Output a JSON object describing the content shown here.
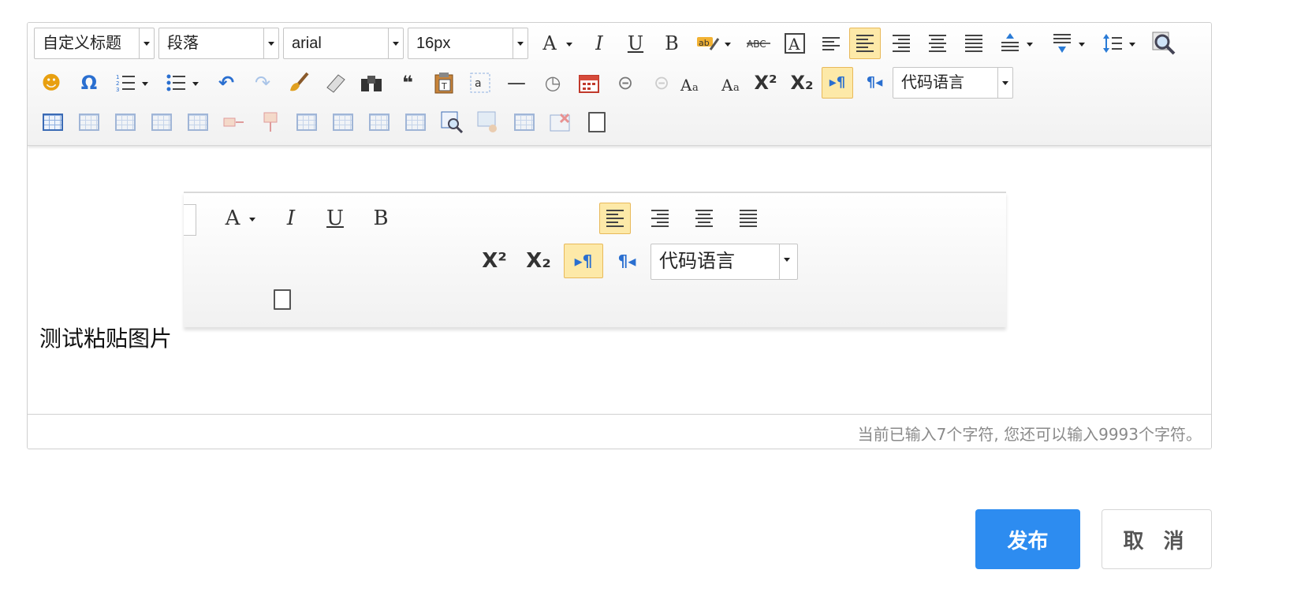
{
  "toolbar": {
    "heading_select": "自定义标题",
    "paragraph_select": "段落",
    "font_family_select": "arial",
    "font_size_select": "16px",
    "code_language_select": "代码语言",
    "icons": {
      "font_color": "A",
      "italic": "I",
      "underline": "U",
      "bold": "B",
      "superscript": "X²",
      "subscript": "X₂",
      "emoticon": "☻",
      "special_char": "Ω",
      "undo": "↶",
      "redo": "↷",
      "blockquote": "❝",
      "horizontal_rule": "—",
      "time": "◷",
      "date": "▦",
      "link": "⊝",
      "unlink": "⊝",
      "ltr": "▸¶",
      "rtl": "¶◂"
    }
  },
  "content": {
    "text": "测试粘贴图片"
  },
  "status": {
    "char_count": "当前已输入7个字符, 您还可以输入9993个字符。"
  },
  "actions": {
    "publish": "发布",
    "cancel": "取 消"
  },
  "colors": {
    "primary": "#2d8cf0",
    "active_button": "#fde9a8",
    "active_border": "#e8b95a"
  }
}
